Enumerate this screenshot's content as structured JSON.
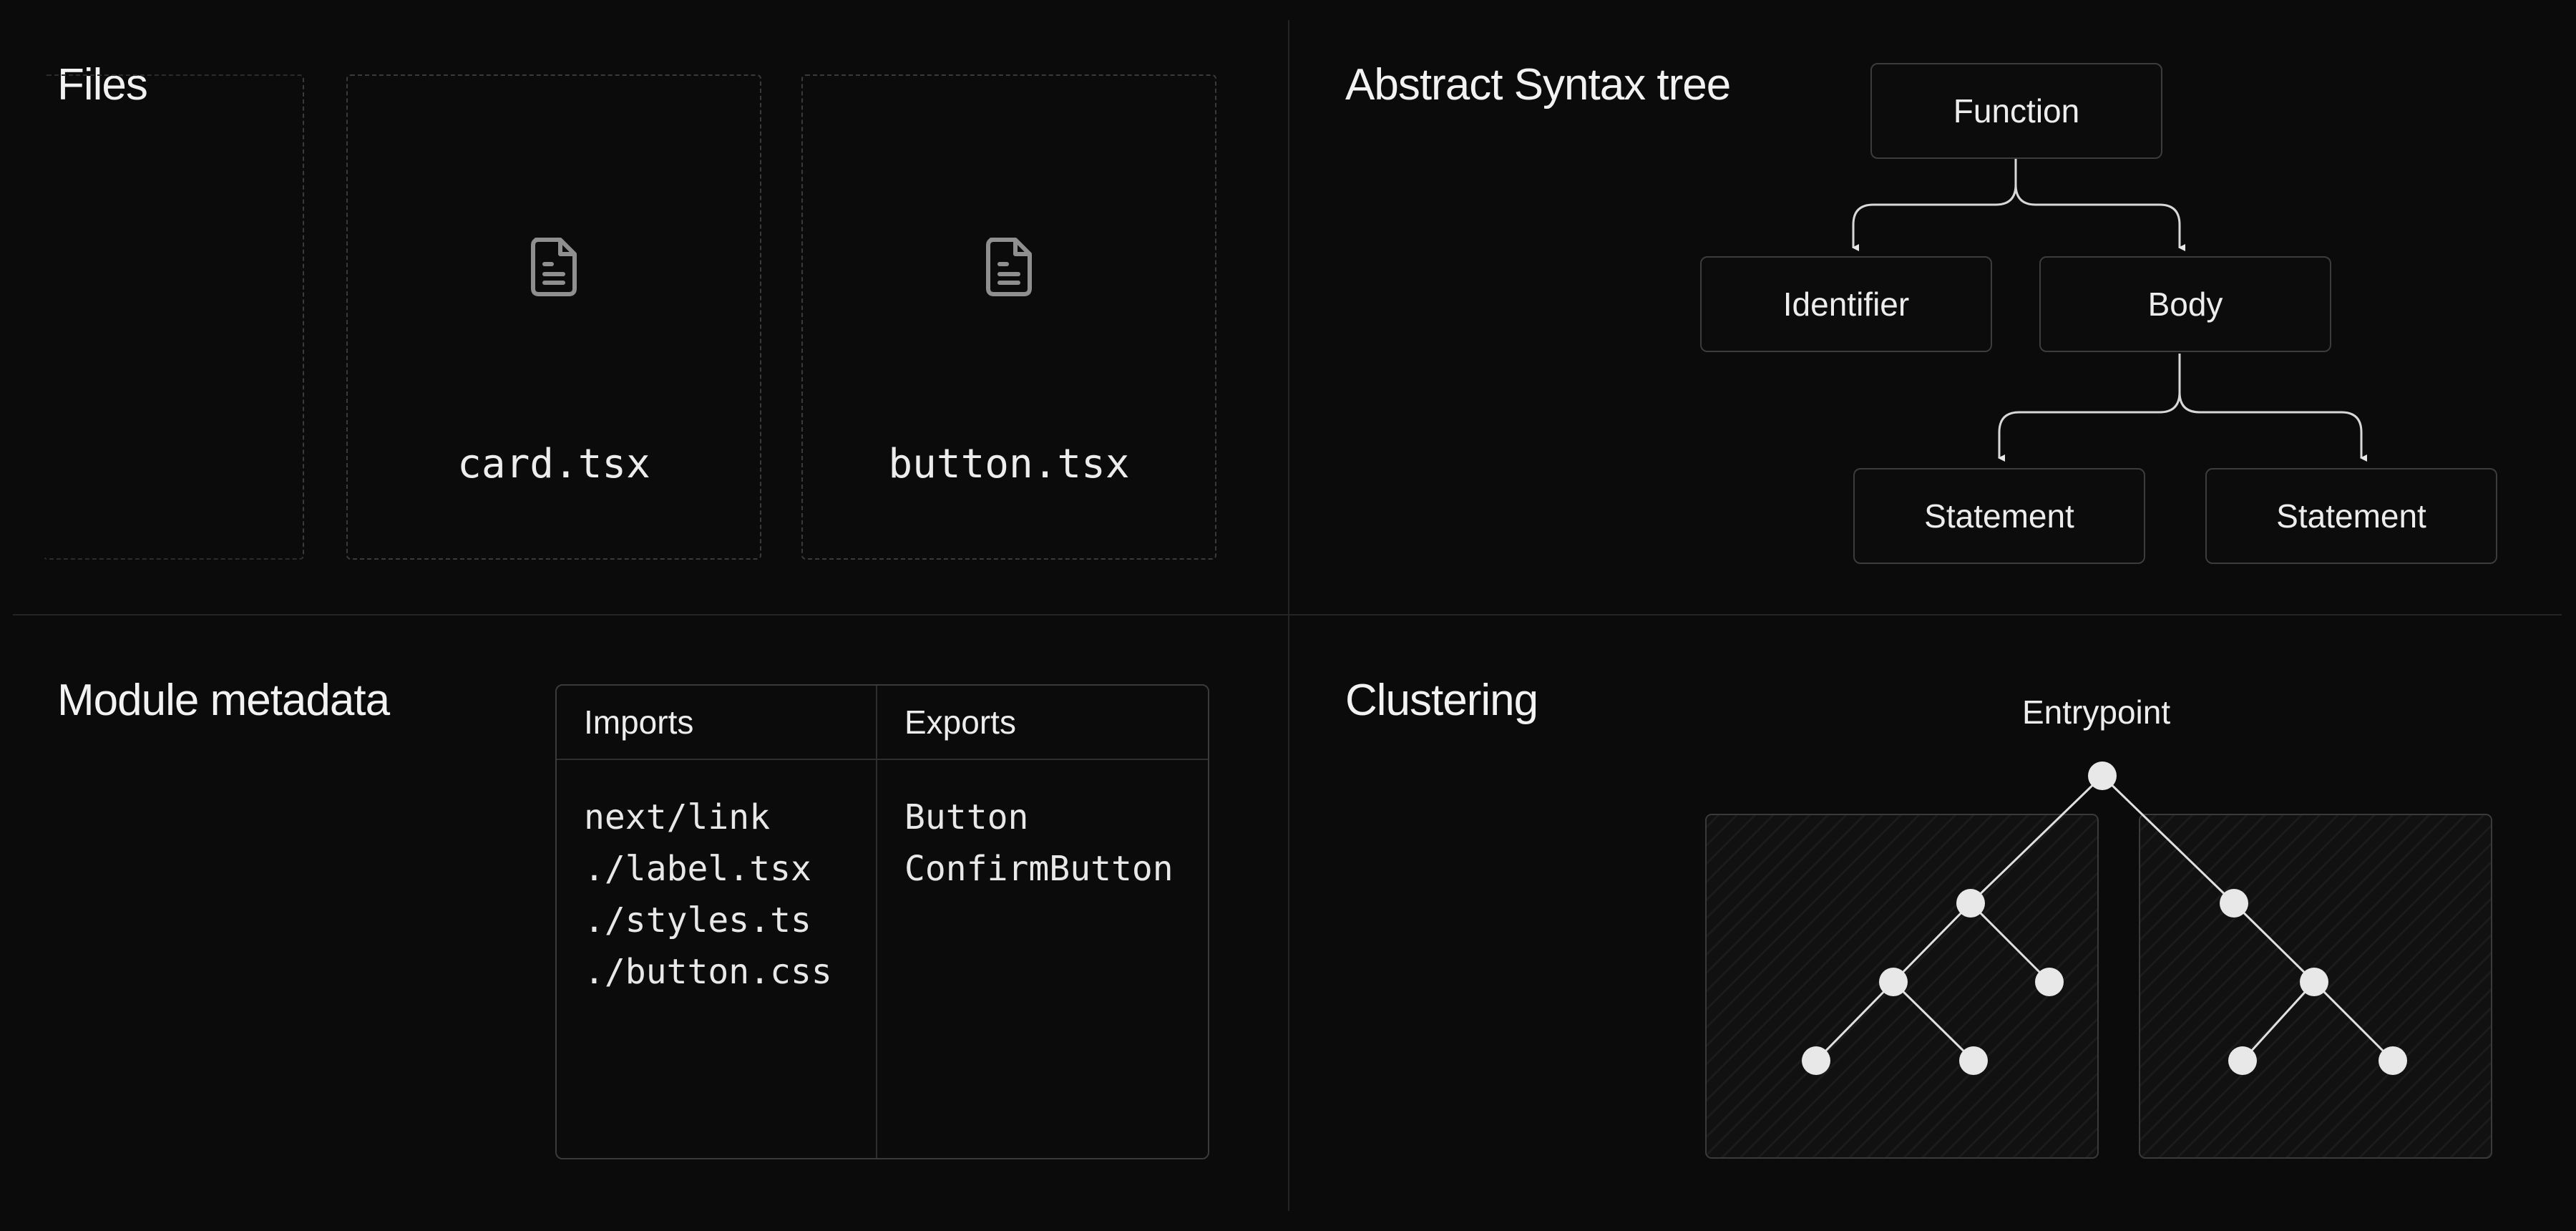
{
  "files": {
    "title": "Files",
    "items": [
      {
        "name": "card.tsx",
        "icon": "file-text-icon"
      },
      {
        "name": "button.tsx",
        "icon": "file-text-icon"
      }
    ]
  },
  "ast": {
    "title": "Abstract Syntax tree",
    "nodes": {
      "function": "Function",
      "identifier": "Identifier",
      "body": "Body",
      "statement_1": "Statement",
      "statement_2": "Statement"
    }
  },
  "module_metadata": {
    "title": "Module metadata",
    "columns": [
      {
        "header": "Imports",
        "items": [
          "next/link",
          "./label.tsx",
          "./styles.ts",
          "./button.css"
        ]
      },
      {
        "header": "Exports",
        "items": [
          "Button",
          "ConfirmButton"
        ]
      }
    ]
  },
  "clustering": {
    "title": "Clustering",
    "entry_label": "Entrypoint"
  },
  "colors": {
    "background": "#0b0b0b",
    "border": "#3c3c3c",
    "text": "#ededed",
    "node": "#e8e8e8"
  }
}
